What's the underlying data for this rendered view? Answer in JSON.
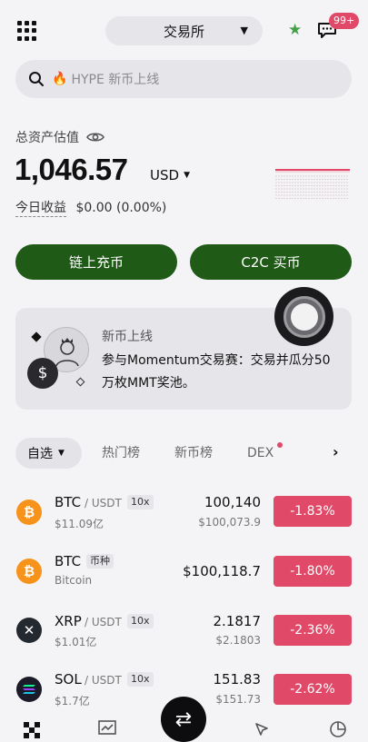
{
  "header": {
    "exchange_label": "交易所",
    "badge": "99+"
  },
  "search": {
    "placeholder": "HYPE 新币上线"
  },
  "assets": {
    "label": "总资产估值",
    "amount": "1,046.57",
    "currency": "USD",
    "pnl_label": "今日收益",
    "pnl_value": "$0.00 (0.00%)"
  },
  "actions": {
    "deposit": "链上充币",
    "c2c": "C2C 买币"
  },
  "banner": {
    "title": "新币上线",
    "text": "参与Momentum交易赛：交易并瓜分50万枚MMT奖池。"
  },
  "tabs": [
    {
      "label": "自选"
    },
    {
      "label": "热门榜"
    },
    {
      "label": "新币榜"
    },
    {
      "label": "DEX"
    }
  ],
  "rows": [
    {
      "symbol": "BTC",
      "pair": "/ USDT",
      "tag": "10x",
      "sub": "$11.09亿",
      "price": "100,140",
      "fiat": "$100,073.9",
      "change": "-1.83%",
      "icon": "bitcoin-icon",
      "color": "#f7931a"
    },
    {
      "symbol": "BTC",
      "pair": "",
      "tag": "币种",
      "sub": "Bitcoin",
      "price": "$100,118.7",
      "fiat": "",
      "change": "-1.80%",
      "icon": "bitcoin-icon",
      "color": "#f7931a"
    },
    {
      "symbol": "XRP",
      "pair": "/ USDT",
      "tag": "10x",
      "sub": "$1.01亿",
      "price": "2.1817",
      "fiat": "$2.1803",
      "change": "-2.36%",
      "icon": "xrp-icon",
      "color": "#23292f"
    },
    {
      "symbol": "SOL",
      "pair": "/ USDT",
      "tag": "10x",
      "sub": "$1.7亿",
      "price": "151.83",
      "fiat": "$151.73",
      "change": "-2.62%",
      "icon": "solana-icon",
      "color": "#1c1b29"
    }
  ],
  "colors": {
    "accent_green": "#1f5a17",
    "negative_red": "#e04a68",
    "star_green": "#43a047"
  }
}
